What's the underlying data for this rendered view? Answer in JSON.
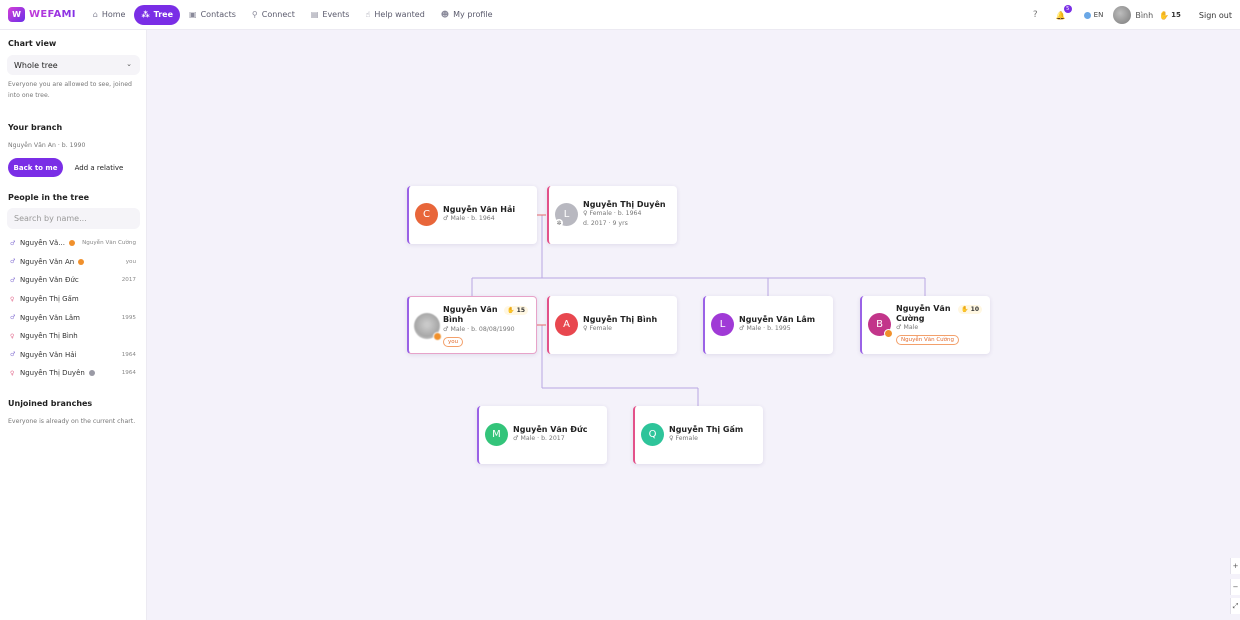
{
  "brand": {
    "name": "WEFAMI",
    "mark": "W"
  },
  "nav": [
    {
      "label": "Home",
      "icon": "⌂"
    },
    {
      "label": "Tree",
      "icon": "⁂"
    },
    {
      "label": "Contacts",
      "icon": "▣"
    },
    {
      "label": "Connect",
      "icon": "⚲"
    },
    {
      "label": "Events",
      "icon": "▤"
    },
    {
      "label": "Help wanted",
      "icon": "☝"
    },
    {
      "label": "My profile",
      "icon": "☻"
    }
  ],
  "header": {
    "help_icon": "?",
    "bell_icon": "🔔",
    "notif_count": "5",
    "lang": "EN",
    "user": "Bình",
    "points": "15",
    "sign_out": "Sign out"
  },
  "sidebar": {
    "chart_view_heading": "Chart view",
    "chart_view_value": "Whole tree",
    "chart_view_note": "Everyone you are allowed to see, joined into one tree.",
    "branch_heading": "Your branch",
    "branch_person": "Nguyễn Văn An · b. 1990",
    "back_button": "Back to me",
    "add_button": "Add a relative",
    "people_heading": "People in the tree",
    "search_placeholder": "Search by name...",
    "people": [
      {
        "gender": "m",
        "name": "Nguyễn Vă...",
        "badge": "orange",
        "meta": "Nguyễn Văn Cường"
      },
      {
        "gender": "m",
        "name": "Nguyễn Văn An",
        "badge": "orange",
        "meta": "you"
      },
      {
        "gender": "m",
        "name": "Nguyễn Văn Đức",
        "badge": "",
        "meta": "2017"
      },
      {
        "gender": "f",
        "name": "Nguyễn Thị Gấm",
        "badge": "",
        "meta": ""
      },
      {
        "gender": "m",
        "name": "Nguyễn Văn Lâm",
        "badge": "",
        "meta": "1995"
      },
      {
        "gender": "f",
        "name": "Nguyễn Thị Bình",
        "badge": "",
        "meta": ""
      },
      {
        "gender": "m",
        "name": "Nguyễn Văn Hải",
        "badge": "",
        "meta": "1964"
      },
      {
        "gender": "f",
        "name": "Nguyễn Thị Duyên",
        "badge": "gray",
        "meta": "1964"
      }
    ],
    "unjoined_heading": "Unjoined branches",
    "unjoined_note": "Everyone is already on the current chart."
  },
  "tree": {
    "hai": {
      "initial": "C",
      "name": "Nguyễn Văn Hải",
      "sub": "♂ Male · b. 1964",
      "color": "#e8663a"
    },
    "duyen": {
      "initial": "L",
      "name": "Nguyễn Thị Duyên",
      "sub": "♀ Female · b. 1964",
      "sub2": "d. 2017 · 9 yrs",
      "color": "#b8b8c0"
    },
    "binh_m": {
      "name": "Nguyễn Văn Bình",
      "sub": "♂ Male · b. 08/08/1990",
      "points": "15",
      "tag": "you"
    },
    "binh_f": {
      "initial": "A",
      "name": "Nguyễn Thị Bình",
      "sub": "♀ Female",
      "color": "#e8474f"
    },
    "lam": {
      "initial": "L",
      "name": "Nguyễn Văn Lâm",
      "sub": "♂ Male · b. 1995",
      "color": "#a03ad6"
    },
    "cuong": {
      "initial": "B",
      "name": "Nguyễn Văn Cường",
      "sub": "♂ Male",
      "points": "10",
      "tag": "Nguyễn Văn Cường",
      "color": "#c2358a"
    },
    "duc": {
      "initial": "M",
      "name": "Nguyễn Văn Đức",
      "sub": "♂ Male · b. 2017",
      "color": "#33c47a"
    },
    "gam": {
      "initial": "Q",
      "name": "Nguyễn Thị Gấm",
      "sub": "♀ Female",
      "color": "#2ec49a"
    }
  },
  "zoom": {
    "in": "+",
    "out": "−",
    "fit": "⤢"
  },
  "colors": {
    "accent": "#7a2ee6",
    "connector": "#b9a6e3",
    "marriage": "#e86a6a"
  }
}
